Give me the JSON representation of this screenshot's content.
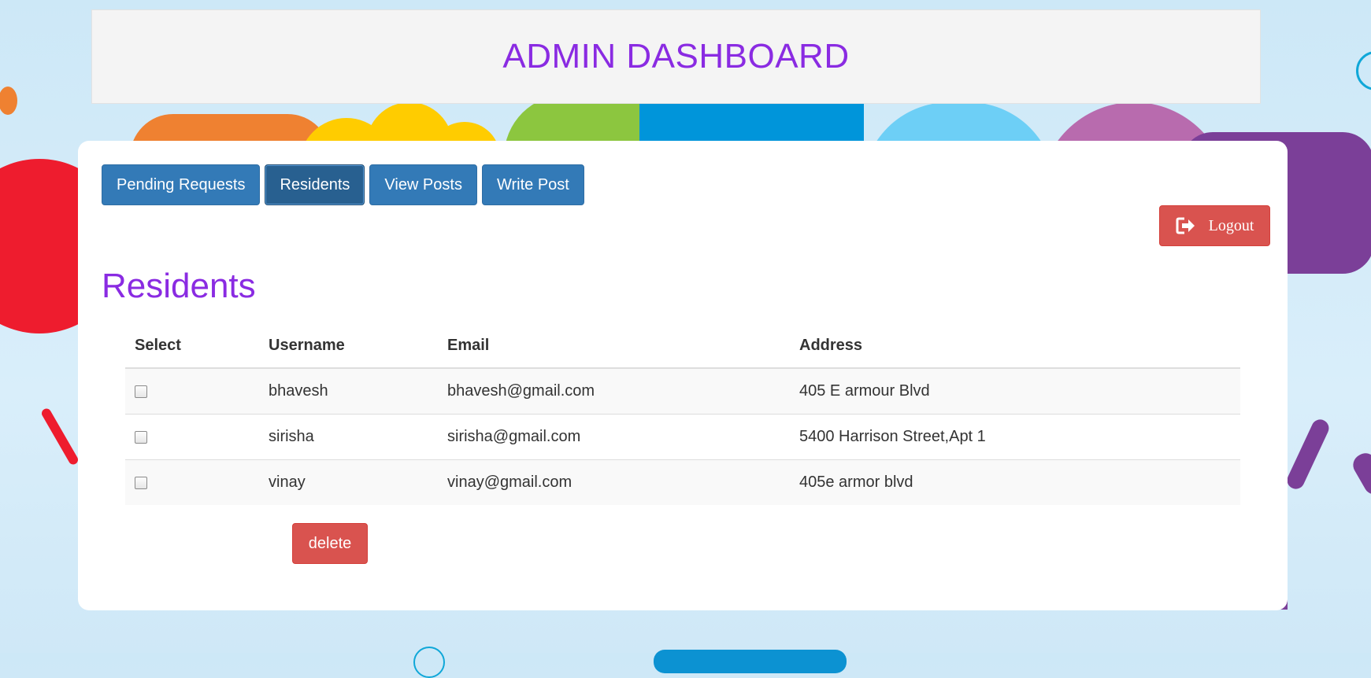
{
  "header": {
    "title": "ADMIN DASHBOARD"
  },
  "nav": {
    "tabs": [
      {
        "label": "Pending Requests",
        "active": false
      },
      {
        "label": "Residents",
        "active": true
      },
      {
        "label": "View Posts",
        "active": false
      },
      {
        "label": "Write Post",
        "active": false
      }
    ]
  },
  "logout": {
    "label": "Logout",
    "icon": "logout-icon"
  },
  "section": {
    "title": "Residents"
  },
  "table": {
    "columns": [
      "Select",
      "Username",
      "Email",
      "Address"
    ],
    "rows": [
      {
        "selected": false,
        "username": "bhavesh",
        "email": "bhavesh@gmail.com",
        "address": "405 E armour Blvd"
      },
      {
        "selected": false,
        "username": "sirisha",
        "email": "sirisha@gmail.com",
        "address": "5400 Harrison Street,Apt 1"
      },
      {
        "selected": false,
        "username": "vinay",
        "email": "vinay@gmail.com",
        "address": "405e armor blvd"
      }
    ]
  },
  "actions": {
    "delete_label": "delete"
  },
  "colors": {
    "title": "#8a2be2",
    "primary": "#337ab7",
    "primary_active": "#286090",
    "danger": "#d9534f"
  }
}
